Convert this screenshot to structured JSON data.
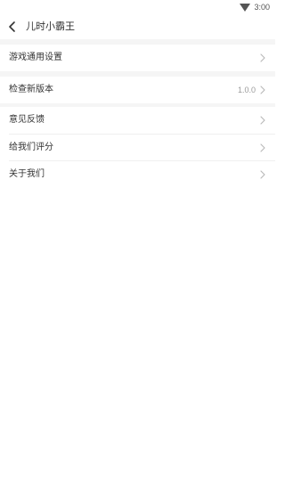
{
  "status_bar": {
    "time": "3:00",
    "wifi_icon": "wifi-icon"
  },
  "header": {
    "back_icon": "chevron-left-icon",
    "title": "儿时小霸王"
  },
  "settings": {
    "game_settings": {
      "label": "游戏通用设置"
    },
    "check_update": {
      "label": "检查新版本",
      "version": "1.0.0"
    },
    "feedback": {
      "label": "意见反馈"
    },
    "rate_us": {
      "label": "给我们评分"
    },
    "about_us": {
      "label": "关于我们"
    }
  },
  "colors": {
    "background": "#ffffff",
    "separator": "#f5f5f5",
    "text": "#333333",
    "secondary_text": "#9a9a9a",
    "chevron": "#b8b8b8"
  }
}
